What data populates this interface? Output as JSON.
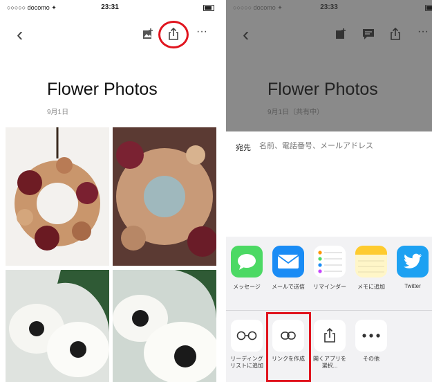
{
  "left": {
    "status": {
      "carrier": "○○○○○ docomo ✦",
      "time": "23:31"
    },
    "nav": {
      "back": "‹",
      "add_photo_icon": "add-photo-icon",
      "share_icon": "share-icon",
      "more": "···"
    },
    "title": "Flower Photos",
    "subtitle": "9月1日"
  },
  "right": {
    "status": {
      "carrier": "○○○○○ docomo ✦",
      "time": "23:33"
    },
    "nav": {
      "back": "‹",
      "more": "···"
    },
    "title": "Flower Photos",
    "subtitle": "9月1日（共有中）",
    "to_label": "宛先",
    "to_placeholder": "名前、電話番号、メールアドレス",
    "apps": [
      {
        "label": "メッセージ",
        "color": "#4cd964"
      },
      {
        "label": "メールで送信",
        "color": "#1a8cf5"
      },
      {
        "label": "リマインダー",
        "color": "#ffffff"
      },
      {
        "label": "メモに追加",
        "color": "#fff6c8"
      },
      {
        "label": "Twitter",
        "color": "#1da1f2"
      }
    ],
    "actions": [
      {
        "label": "リーディング\nリストに追加"
      },
      {
        "label": "リンクを作成"
      },
      {
        "label": "開くアプリを\n選択..."
      },
      {
        "label": "その他"
      }
    ]
  },
  "colors": {
    "highlight": "#e0141e"
  }
}
